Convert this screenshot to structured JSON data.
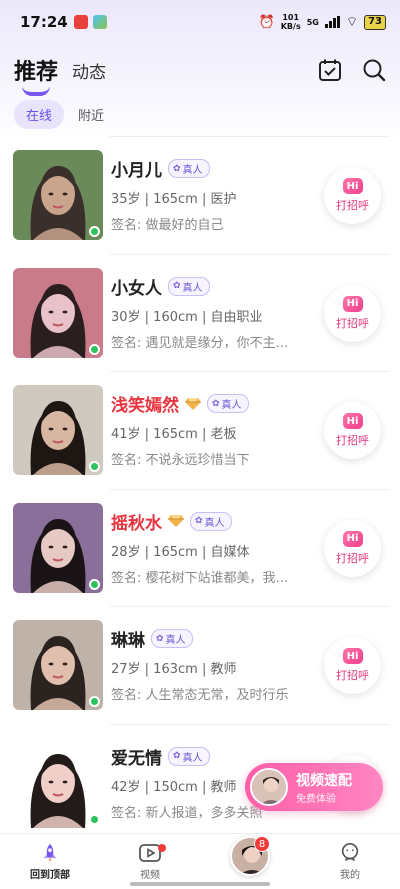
{
  "status_bar": {
    "time": "17:24",
    "net_speed": "101",
    "net_unit": "KB/s",
    "net_type": "5G",
    "battery": "73"
  },
  "header": {
    "tab_recommend": "推荐",
    "tab_feed": "动态"
  },
  "subtabs": {
    "online": "在线",
    "nearby": "附近"
  },
  "verified_label": "真人",
  "hi_icon_text": "Hi",
  "greet_label": "打招呼",
  "users": [
    {
      "name": "小月儿",
      "vip": false,
      "info": "35岁 | 165cm | 医护",
      "sign": "签名: 做最好的自己",
      "colors": [
        "#3a2f2a",
        "#c9a58e",
        "#6b8a5a"
      ]
    },
    {
      "name": "小女人",
      "vip": false,
      "info": "30岁 | 160cm | 自由职业",
      "sign": "签名: 遇见就是缘分，你不主…",
      "colors": [
        "#2a1e1e",
        "#e8c2c8",
        "#c97b8a"
      ]
    },
    {
      "name": "浅笑嫣然",
      "vip": true,
      "info": "41岁 | 165cm | 老板",
      "sign": "签名: 不说永远珍惜当下",
      "colors": [
        "#1e1612",
        "#d7b7a2",
        "#cfc9c0"
      ]
    },
    {
      "name": "摇秋水",
      "vip": true,
      "info": "28岁 | 165cm | 自媒体",
      "sign": "签名: 樱花树下站谁都美，我…",
      "colors": [
        "#1a1416",
        "#e6c9c2",
        "#8a6f9a"
      ]
    },
    {
      "name": "琳琳",
      "vip": false,
      "info": "27岁 | 163cm | 教师",
      "sign": "签名: 人生常态无常，及时行乐",
      "colors": [
        "#2b2320",
        "#e0bfae",
        "#bfb2a8"
      ]
    },
    {
      "name": "爱无情",
      "vip": false,
      "info": "42岁 | 150cm | 教师",
      "sign": "签名: 新人报道，多多关照",
      "colors": [
        "#231a1a",
        "#f0cfc8",
        "#ffffff"
      ]
    }
  ],
  "float_cta": {
    "title": "视频速配",
    "subtitle": "免费体验"
  },
  "bottom_nav": {
    "home": "回到顶部",
    "video": "视频",
    "center_badge": "8",
    "mine": "我的"
  }
}
